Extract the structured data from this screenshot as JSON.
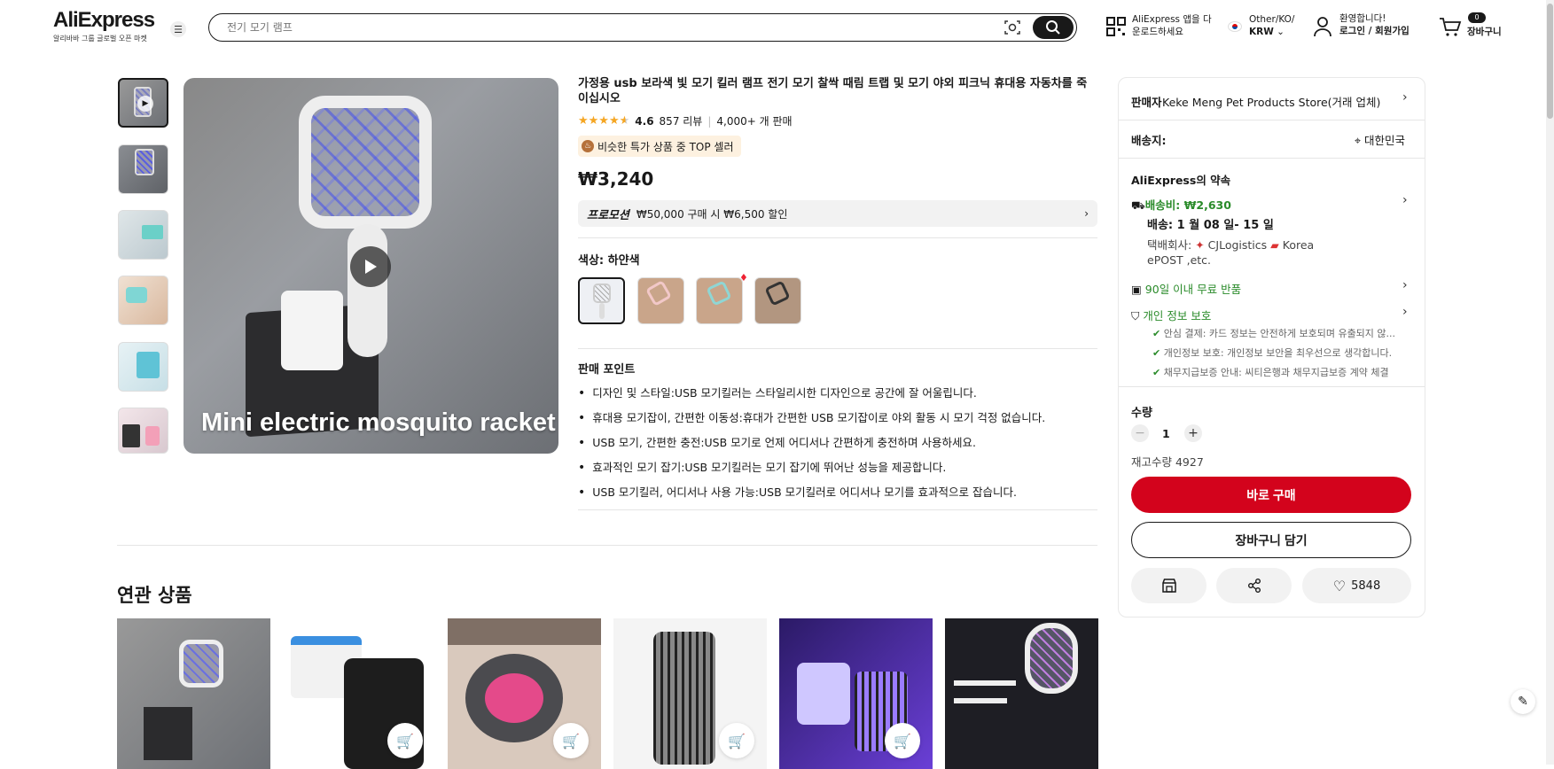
{
  "header": {
    "logo": "AliExpress",
    "logo_sub": "알리바바 그룹 글로벌 오픈 마켓",
    "menu_icon": "menu-icon",
    "search_placeholder": "전기 모기 램프",
    "app_line1": "AliExpress 앱을 다",
    "app_line2": "운로드하세요",
    "locale_line1": "Other/KO/",
    "locale_line2": "KRW",
    "account_line1": "환영합니다!",
    "account_line2": "로그인 / 회원가입",
    "cart_count": "0",
    "cart_label": "장바구니"
  },
  "gallery": {
    "caption": "Mini electric mosquito racket"
  },
  "product": {
    "title": "가정용 usb 보라색 빛 모기 킬러 램프 전기 모기 찰싹 때림 트랩 및 모기 야외 피크닉 휴대용 자동차를 죽이십시오",
    "rating": "4.6",
    "reviews": "857 리뷰",
    "sold": "4,000+ 개 판매",
    "badge": "비슷한 특가 상품 중 TOP 셀러",
    "price": "₩3,240",
    "promo_label": "프로모션",
    "promo_text": "₩50,000 구매 시 ₩6,500 할인",
    "color_label": "색상: 하얀색",
    "selling_points_title": "판매 포인트",
    "selling_points": [
      "디자인 및 스타일:USB 모기킬러는 스타일리시한 디자인으로 공간에 잘 어울립니다.",
      "휴대용 모기잡이, 간편한 이동성:휴대가 간편한 USB 모기잡이로 야외 활동 시 모기 걱정 없습니다.",
      "USB 모기, 간편한 충전:USB 모기로 언제 어디서나 간편하게 충전하며 사용하세요.",
      "효과적인 모기 잡기:USB 모기킬러는 모기 잡기에 뛰어난 성능을 제공합니다.",
      "USB 모기킬러, 어디서나 사용 가능:USB 모기킬러로 어디서나 모기를 효과적으로 잡습니다."
    ]
  },
  "related": {
    "title": "연관 상품"
  },
  "panel": {
    "seller_label": "판매자",
    "seller_name": "Keke Meng Pet Products Store(거래 업체)",
    "ship_to_label": "배송지:",
    "ship_to": "대한민국",
    "promise_title": "AliExpress의 약속",
    "shipping_fee": "배송비: ₩2,630",
    "delivery": "배송: 1 월 08 일- 15 일",
    "carrier_label": "택배회사:",
    "carrier1": "CJLogistics",
    "carrier2": "Korea",
    "carrier3": "ePOST ,etc.",
    "returns": "90일 이내 무료 반품",
    "privacy": "개인 정보 보호",
    "privacy_items": [
      "안심 결제: 카드 정보는 안전하게 보호되며 유출되지 않...",
      "개인정보 보호: 개인정보 보안을 최우선으로 생각합니다.",
      "채무지급보증 안내: 씨티은행과 채무지급보증 계약 체결"
    ],
    "qty_label": "수량",
    "qty": "1",
    "stock": "재고수량 4927",
    "buy_now": "바로 구매",
    "add_cart": "장바구니 담기",
    "wishlist_count": "5848"
  },
  "colors": {
    "accent_red": "#d3031c",
    "green": "#2a8b2a",
    "star": "#f5a623"
  }
}
